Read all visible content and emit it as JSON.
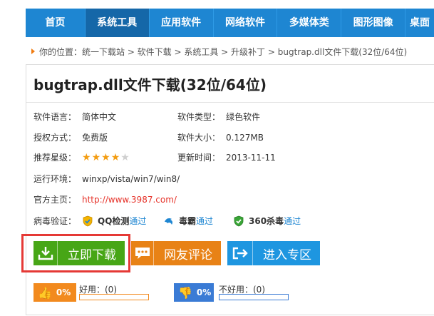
{
  "nav": {
    "items": [
      "首页",
      "系统工具",
      "应用软件",
      "网络软件",
      "多媒体类",
      "图形图像",
      "桌面"
    ],
    "active_index": 1
  },
  "breadcrumb": "你的位置：统一下载站 > 软件下载 > 系统工具 > 升级补丁 > bugtrap.dll文件下载(32位/64位)",
  "title": "bugtrap.dll文件下载(32位/64位)",
  "info": {
    "language_label": "软件语言：",
    "language": "简体中文",
    "type_label": "软件类型：",
    "type": "绿色软件",
    "license_label": "授权方式：",
    "license": "免费版",
    "size_label": "软件大小：",
    "size": "0.127MB",
    "rating_label": "推荐星级：",
    "rating_stars": 4,
    "rating_max": 5,
    "updated_label": "更新时间：",
    "updated": "2013-11-11",
    "env_label": "运行环境：",
    "env": "winxp/vista/win7/win8/",
    "homepage_label": "官方主页：",
    "homepage": "http://www.3987.com/",
    "virus_label": "病毒验证："
  },
  "scans": [
    {
      "name": "QQ检测",
      "result": "通过",
      "icon": "qq-shield-icon",
      "color": "#f5b400"
    },
    {
      "name": "毒霸",
      "result": "通过",
      "icon": "duba-icon",
      "color": "#1e86d2"
    },
    {
      "name": "360杀毒",
      "result": "通过",
      "icon": "360-shield-icon",
      "color": "#3aa537"
    }
  ],
  "buttons": {
    "download": "立即下载",
    "comment": "网友评论",
    "zone": "进入专区"
  },
  "ratings": {
    "good_percent": "0%",
    "good_label": "好用：(0)",
    "bad_percent": "0%",
    "bad_label": "不好用：(0)"
  },
  "colors": {
    "nav": "#1e86d2",
    "nav_active": "#1567a8",
    "download": "#47a616",
    "comment": "#e88216",
    "zone": "#1e96e0",
    "highlight": "#e53935",
    "link": "#e6332a"
  }
}
